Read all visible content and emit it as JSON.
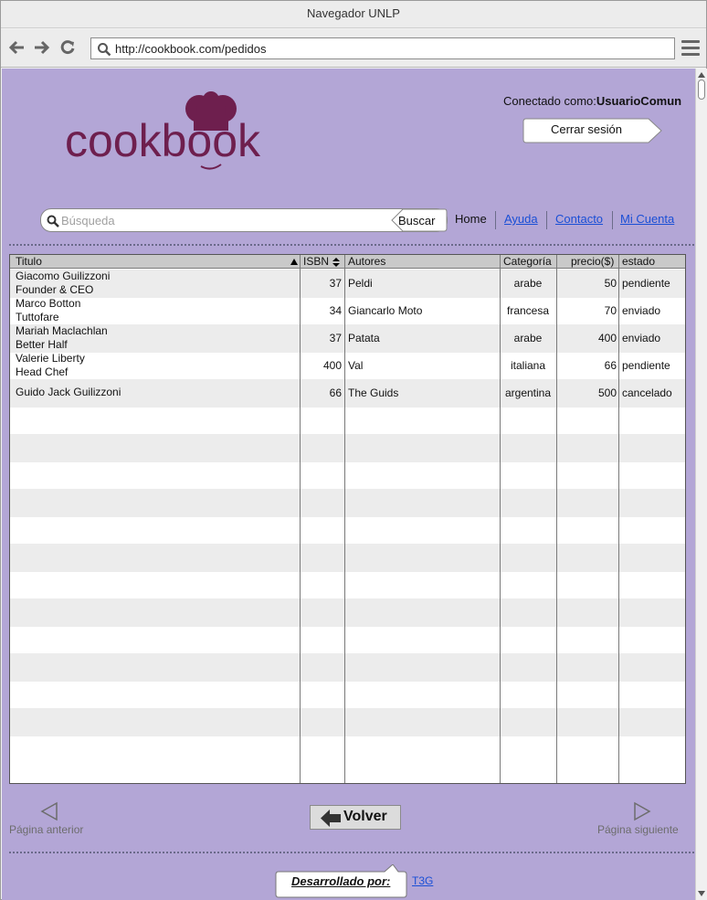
{
  "browser": {
    "title": "Navegador UNLP",
    "url": "http://cookbook.com/pedidos"
  },
  "header": {
    "logo_text": "cookbook",
    "login_label": "Conectado como:",
    "login_user": "UsuarioComun",
    "logout_label": "Cerrar sesión"
  },
  "search": {
    "placeholder": "Búsqueda",
    "button_label": "Buscar"
  },
  "nav": {
    "home": "Home",
    "help": "Ayuda",
    "contact": "Contacto",
    "account": " Mi Cuenta"
  },
  "table": {
    "columns": [
      "Titulo",
      "ISBN",
      "Autores",
      "Categoría",
      "precio($)",
      "estado"
    ],
    "rows": [
      {
        "titulo": "Giacomo Guilizzoni",
        "subtitulo": "Founder & CEO",
        "isbn": "37",
        "autores": "Peldi",
        "categoria": "arabe",
        "precio": "50",
        "estado": "pendiente"
      },
      {
        "titulo": "Marco Botton",
        "subtitulo": "Tuttofare",
        "isbn": "34",
        "autores": "Giancarlo Moto",
        "categoria": "francesa",
        "precio": "70",
        "estado": "enviado"
      },
      {
        "titulo": "Mariah Maclachlan",
        "subtitulo": "Better Half",
        "isbn": "37",
        "autores": "Patata",
        "categoria": "arabe",
        "precio": "400",
        "estado": "enviado"
      },
      {
        "titulo": "Valerie Liberty",
        "subtitulo": "Head Chef",
        "isbn": "400",
        "autores": "Val",
        "categoria": "italiana",
        "precio": "66",
        "estado": "pendiente"
      },
      {
        "titulo": "Guido Jack Guilizzoni",
        "subtitulo": "",
        "isbn": "66",
        "autores": "The Guids",
        "categoria": "argentina",
        "precio": "500",
        "estado": "cancelado"
      }
    ]
  },
  "pagination": {
    "previous": "Página anterior",
    "next": "Página siguiente",
    "back": "Volver"
  },
  "footer": {
    "developed_by": "Desarrollado por:",
    "team": "T3G"
  },
  "colors": {
    "page_bg": "#b3a6d6",
    "logo": "#6e1f4e",
    "link": "#1a4fd6"
  }
}
